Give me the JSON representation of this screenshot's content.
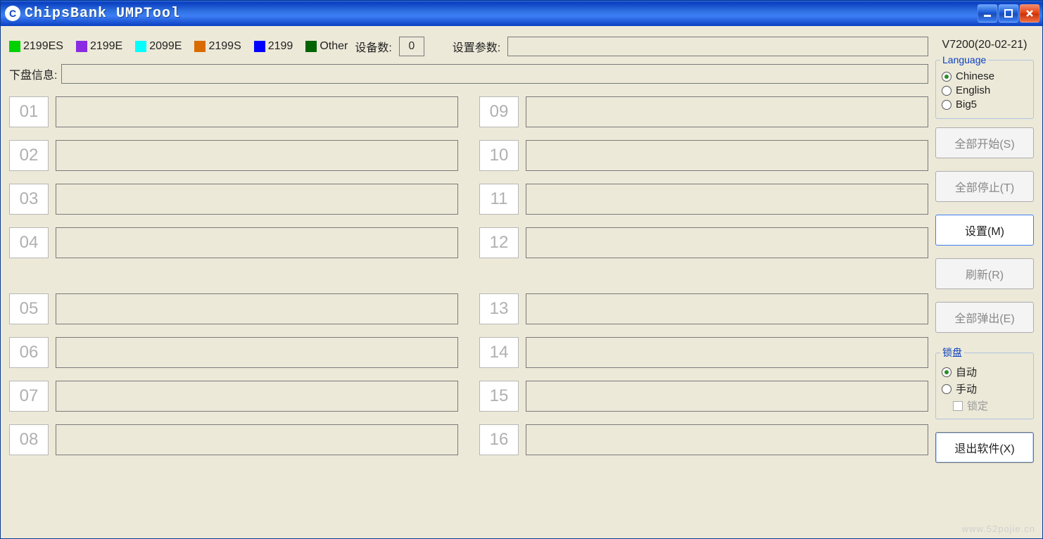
{
  "title": "ChipsBank UMPTool",
  "legend": [
    {
      "label": "2199ES",
      "color": "#00d100"
    },
    {
      "label": "2199E",
      "color": "#8a2be2"
    },
    {
      "label": "2099E",
      "color": "#00ffff"
    },
    {
      "label": "2199S",
      "color": "#d96c00"
    },
    {
      "label": "2199",
      "color": "#0000ff"
    },
    {
      "label": "Other",
      "color": "#006400"
    }
  ],
  "labels": {
    "device_count": "设备数:",
    "settings_param": "设置参数:",
    "disk_info": "下盘信息:"
  },
  "device_count": "0",
  "version": "V7200(20-02-21)",
  "language": {
    "title": "Language",
    "options": [
      "Chinese",
      "English",
      "Big5"
    ],
    "selected": "Chinese"
  },
  "buttons": {
    "start_all": "全部开始(S)",
    "stop_all": "全部停止(T)",
    "settings": "设置(M)",
    "refresh": "刷新(R)",
    "eject_all": "全部弹出(E)",
    "exit": "退出软件(X)"
  },
  "lock": {
    "title": "锁盘",
    "options": [
      "自动",
      "手动"
    ],
    "selected": "自动",
    "lock_label": "锁定"
  },
  "slots_left": [
    "01",
    "02",
    "03",
    "04",
    "05",
    "06",
    "07",
    "08"
  ],
  "slots_right": [
    "09",
    "10",
    "11",
    "12",
    "13",
    "14",
    "15",
    "16"
  ],
  "watermark": "www.52pojie.cn"
}
